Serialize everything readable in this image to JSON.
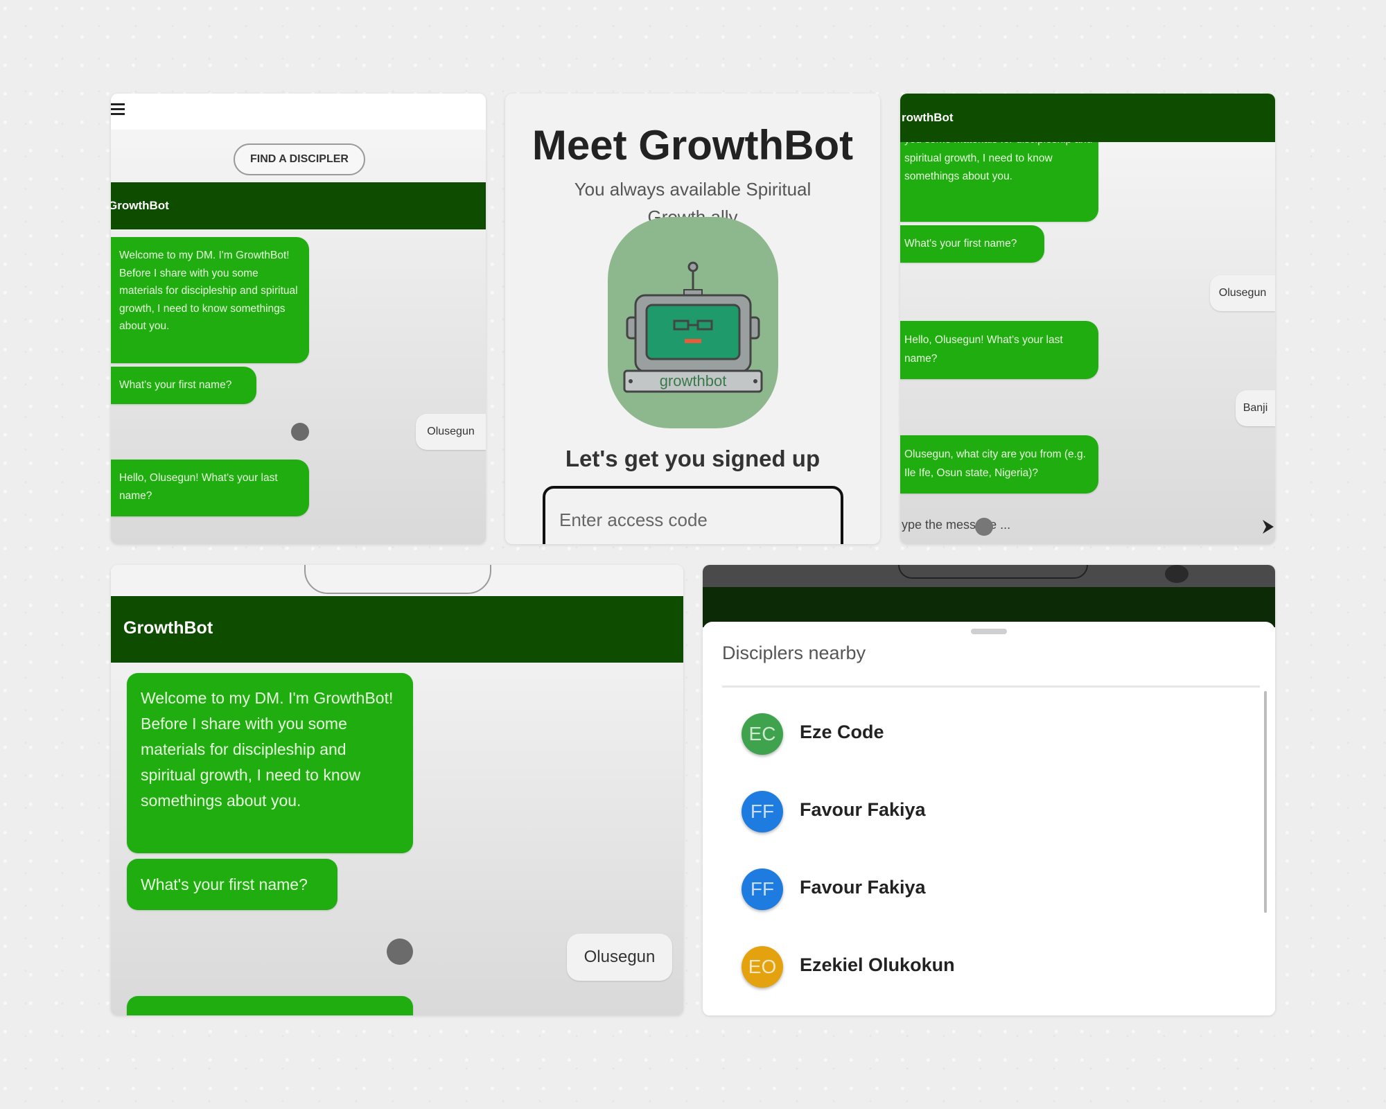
{
  "app": {
    "menu_icon": "hamburger-menu-icon",
    "find_discipler_label": "FIND A DISCIPLER",
    "title": "GrowthBot",
    "title_clipped": "GrowthBot",
    "title_clipped2": "rowthBot"
  },
  "chat": {
    "welcome": "Welcome to my DM. I'm GrowthBot! Before I share with you some materials for discipleship and spiritual growth, I need to know somethings about you.",
    "welcome_partial": "you some materials for discipleship and spiritual growth, I need to know somethings about you.",
    "ask_first_name": "What's your first name?",
    "first_name_reply": "Olusegun",
    "ask_last_name": "Hello, Olusegun! What's your last name?",
    "last_name_reply": "Banji",
    "ask_city": "Olusegun, what city are you from (e.g. Ile Ife, Osun state, Nigeria)?",
    "input_placeholder": "ype the message ...",
    "send_icon": "send-arrow-icon"
  },
  "signup": {
    "heading": "Meet GrowthBot",
    "tagline": "You always available Spiritual Growth ally",
    "robot_caption": "growthbot",
    "subheading": "Let's get you signed up",
    "access_code_placeholder": "Enter access code"
  },
  "nearby": {
    "title": "Disciplers nearby",
    "people": [
      {
        "initials": "EC",
        "name": "Eze Code",
        "color": "#3fa34d"
      },
      {
        "initials": "FF",
        "name": "Favour Fakiya",
        "color": "#1e7be0"
      },
      {
        "initials": "FF",
        "name": "Favour Fakiya",
        "color": "#1e7be0"
      },
      {
        "initials": "EO",
        "name": "Ezekiel Olukokun",
        "color": "#e3a20e"
      }
    ]
  },
  "colors": {
    "app_bar": "#0e4d00",
    "bot_bubble": "#1fad0f",
    "user_bubble": "#f2f2f2"
  }
}
